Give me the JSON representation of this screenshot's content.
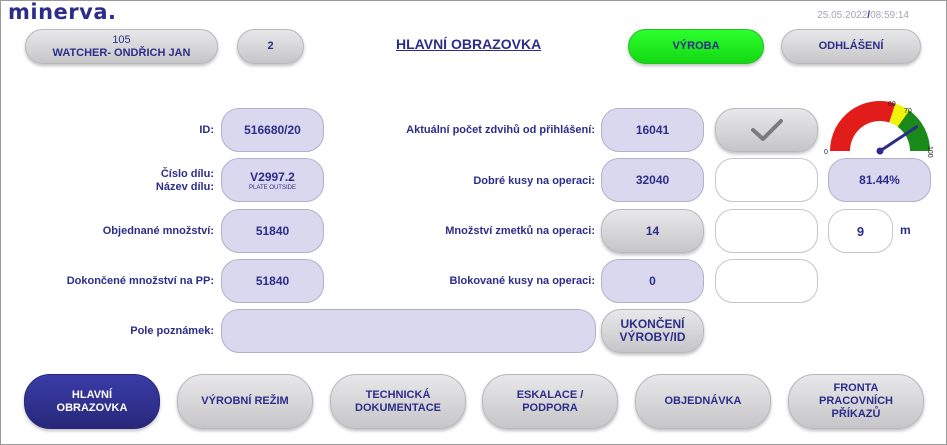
{
  "app": {
    "logo": "minerva."
  },
  "header": {
    "date": "25.05.2022",
    "separator": "/",
    "time": "08:59:14",
    "user_id": "105",
    "user_name": "WATCHER- ONDŘICH JAN",
    "shift": "2",
    "title": "HLAVNÍ OBRAZOVKA",
    "mode_button": "VÝROBA",
    "logout_button": "ODHLÁŠENÍ"
  },
  "fields": {
    "id_label": "ID:",
    "id_value": "516680/20",
    "part_number_label": "Číslo dílu:",
    "part_name_label": "Název dílu:",
    "part_number": "V2997.2",
    "part_name": "PLATE OUTSIDE",
    "ordered_label": "Objednané množství:",
    "ordered_value": "51840",
    "done_label": "Dokončené množství na PP:",
    "done_value": "51840",
    "notes_label": "Pole poznámek:",
    "notes_value": ""
  },
  "counters": {
    "strokes_label": "Aktuální počet zdvihů od přihlášení:",
    "strokes_value": "16041",
    "good_label": "Dobré kusy na operaci:",
    "good_value": "32040",
    "scrap_label": "Množství zmetků na operaci:",
    "scrap_value": "14",
    "blocked_label": "Blokované kusy na operaci:",
    "blocked_value": "0",
    "end_button_line1": "UKONČENÍ",
    "end_button_line2": "VÝROBY/ID"
  },
  "gauge": {
    "label_0": "0",
    "label_60": "60",
    "label_70": "70",
    "label_100": "100",
    "value_percent": 81.44,
    "value_text": "81.44%",
    "colors": {
      "red": "#e21b1b",
      "yellow": "#f2f20a",
      "green": "#1a8a1a",
      "needle": "#2c2d8a"
    }
  },
  "minutes": {
    "value": "9",
    "unit": "m"
  },
  "nav": {
    "main": [
      "HLAVNÍ",
      "OBRAZOVKA"
    ],
    "production_mode": "VÝROBNÍ REŽIM",
    "tech_doc": [
      "TECHNICKÁ",
      "DOKUMENTACE"
    ],
    "escalation": [
      "ESKALACE /",
      "PODPORA"
    ],
    "order": "OBJEDNÁVKA",
    "queue": [
      "FRONTA",
      "PRACOVNÍCH",
      "PŘÍKAZŮ"
    ]
  },
  "colors": {
    "brand": "#2c2d8a",
    "field_bg": "#d9d8ee",
    "active_green": "#1ee01e"
  }
}
